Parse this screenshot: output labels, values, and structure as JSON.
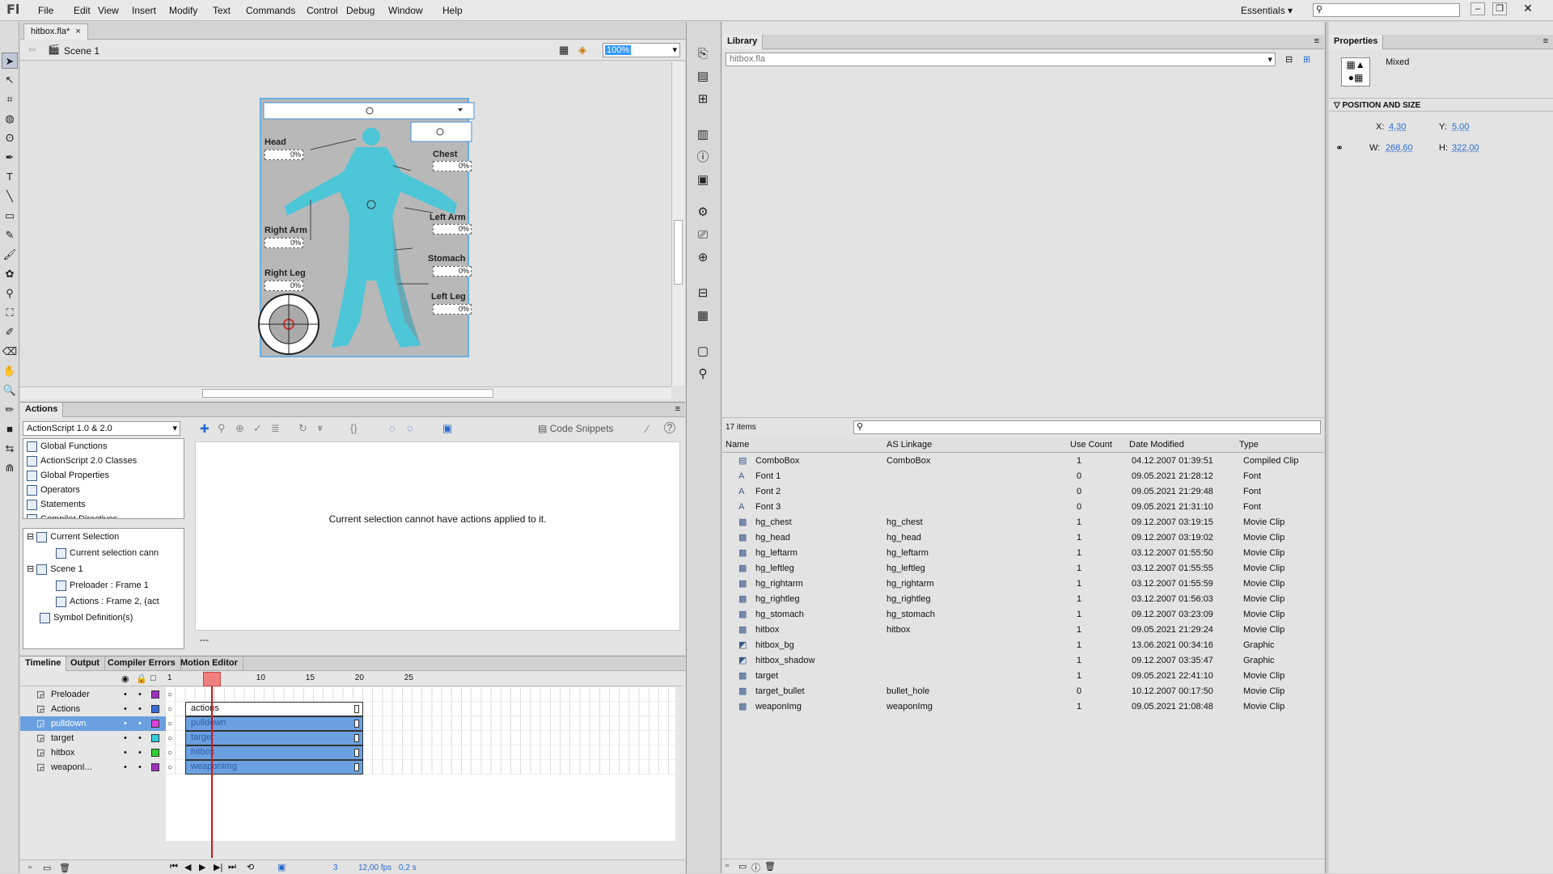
{
  "app": {
    "logo": "Fl",
    "workspace": "Essentials"
  },
  "menu": [
    "File",
    "Edit",
    "View",
    "Insert",
    "Modify",
    "Text",
    "Commands",
    "Control",
    "Debug",
    "Window",
    "Help"
  ],
  "document": {
    "tab": "hitbox.fla*",
    "close": "×",
    "scene": "Scene 1",
    "zoom": "100%"
  },
  "stage": {
    "labels": {
      "head": "Head",
      "chest": "Chest",
      "right_arm": "Right Arm",
      "left_arm": "Left Arm",
      "stomach": "Stomach",
      "right_leg": "Right Leg",
      "left_leg": "Left Leg"
    },
    "pct": "0%"
  },
  "actions": {
    "title": "Actions",
    "language": "ActionScript 1.0 & 2.0",
    "code_snippets": "Code Snippets",
    "message": "Current selection cannot have actions applied to it.",
    "line_num": "---",
    "toolbox": [
      "Global Functions",
      "ActionScript 2.0 Classes",
      "Global Properties",
      "Operators",
      "Statements",
      "Compiler Directives"
    ],
    "tree": [
      "Current Selection",
      "Current selection cann",
      "Scene 1",
      "Preloader : Frame 1",
      "Actions : Frame 2, (act",
      "Symbol Definition(s)"
    ]
  },
  "timeline": {
    "tabs": [
      "Timeline",
      "Output",
      "Compiler Errors",
      "Motion Editor"
    ],
    "frame_nums": [
      "1",
      "5",
      "10",
      "15",
      "20",
      "25"
    ],
    "layers": [
      {
        "name": "Preloader",
        "color": "#a030c0"
      },
      {
        "name": "Actions",
        "color": "#3a6ad6"
      },
      {
        "name": "pulldown",
        "color": "#e040e0"
      },
      {
        "name": "target",
        "color": "#30d0e0"
      },
      {
        "name": "hitbox",
        "color": "#30d030"
      },
      {
        "name": "weaponI...",
        "color": "#a030c0"
      }
    ],
    "frame_labels": [
      "actions",
      "pulldown",
      "target",
      "hitbox",
      "weaponImg"
    ],
    "status": {
      "frame": "3",
      "fps": "12,00",
      "fps_unit": "fps",
      "time": "0,2",
      "time_unit": "s"
    }
  },
  "library": {
    "title": "Library",
    "file": "hitbox.fla",
    "count": "17 items",
    "columns": [
      "Name",
      "AS Linkage",
      "Use Count",
      "Date Modified",
      "Type"
    ],
    "items": [
      {
        "name": "ComboBox",
        "link": "ComboBox",
        "use": "1",
        "date": "04.12.2007 01:39:51",
        "type": "Compiled Clip",
        "icon": "clip"
      },
      {
        "name": "Font 1",
        "link": "",
        "use": "0",
        "date": "09.05.2021 21:28:12",
        "type": "Font",
        "icon": "font"
      },
      {
        "name": "Font 2",
        "link": "",
        "use": "0",
        "date": "09.05.2021 21:29:48",
        "type": "Font",
        "icon": "font"
      },
      {
        "name": "Font 3",
        "link": "",
        "use": "0",
        "date": "09.05.2021 21:31:10",
        "type": "Font",
        "icon": "font"
      },
      {
        "name": "hg_chest",
        "link": "hg_chest",
        "use": "1",
        "date": "09.12.2007 03:19:15",
        "type": "Movie Clip",
        "icon": "mc"
      },
      {
        "name": "hg_head",
        "link": "hg_head",
        "use": "1",
        "date": "09.12.2007 03:19:02",
        "type": "Movie Clip",
        "icon": "mc"
      },
      {
        "name": "hg_leftarm",
        "link": "hg_leftarm",
        "use": "1",
        "date": "03.12.2007 01:55:50",
        "type": "Movie Clip",
        "icon": "mc"
      },
      {
        "name": "hg_leftleg",
        "link": "hg_leftleg",
        "use": "1",
        "date": "03.12.2007 01:55:55",
        "type": "Movie Clip",
        "icon": "mc"
      },
      {
        "name": "hg_rightarm",
        "link": "hg_rightarm",
        "use": "1",
        "date": "03.12.2007 01:55:59",
        "type": "Movie Clip",
        "icon": "mc"
      },
      {
        "name": "hg_rightleg",
        "link": "hg_rightleg",
        "use": "1",
        "date": "03.12.2007 01:56:03",
        "type": "Movie Clip",
        "icon": "mc"
      },
      {
        "name": "hg_stomach",
        "link": "hg_stomach",
        "use": "1",
        "date": "09.12.2007 03:23:09",
        "type": "Movie Clip",
        "icon": "mc"
      },
      {
        "name": "hitbox",
        "link": "hitbox",
        "use": "1",
        "date": "09.05.2021 21:29:24",
        "type": "Movie Clip",
        "icon": "mc"
      },
      {
        "name": "hitbox_bg",
        "link": "",
        "use": "1",
        "date": "13.06.2021 00:34:16",
        "type": "Graphic",
        "icon": "gr"
      },
      {
        "name": "hitbox_shadow",
        "link": "",
        "use": "1",
        "date": "09.12.2007 03:35:47",
        "type": "Graphic",
        "icon": "gr"
      },
      {
        "name": "target",
        "link": "",
        "use": "1",
        "date": "09.05.2021 22:41:10",
        "type": "Movie Clip",
        "icon": "mc"
      },
      {
        "name": "target_bullet",
        "link": "bullet_hole",
        "use": "0",
        "date": "10.12.2007 00:17:50",
        "type": "Movie Clip",
        "icon": "mc"
      },
      {
        "name": "weaponImg",
        "link": "weaponImg",
        "use": "1",
        "date": "09.05.2021 21:08:48",
        "type": "Movie Clip",
        "icon": "mc"
      }
    ]
  },
  "properties": {
    "title": "Properties",
    "selection": "Mixed",
    "section": "POSITION AND SIZE",
    "x_label": "X:",
    "x": "4,30",
    "y_label": "Y:",
    "y": "5,00",
    "w_label": "W:",
    "w": "268,60",
    "h_label": "H:",
    "h": "322,00"
  }
}
